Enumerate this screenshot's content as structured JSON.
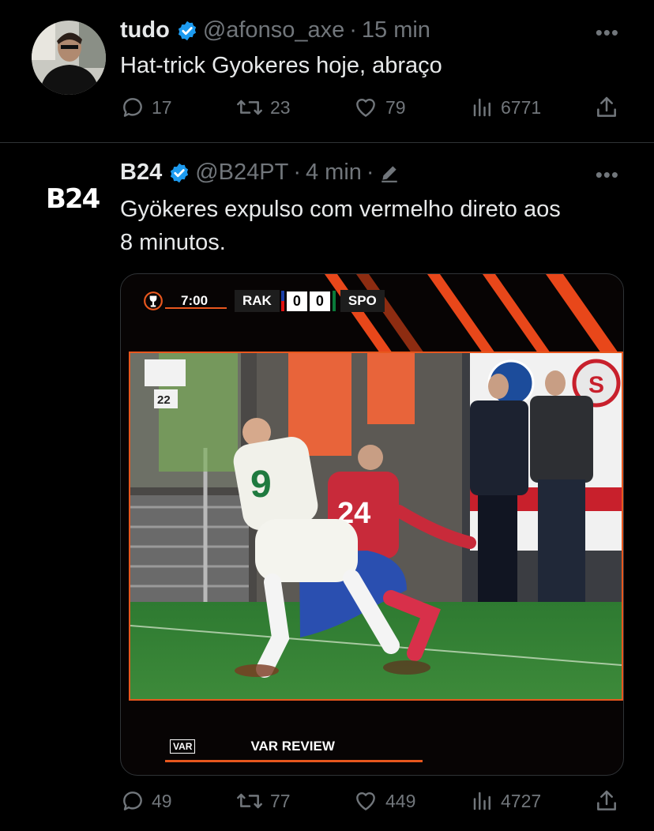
{
  "tweets": [
    {
      "author": {
        "name": "tudo",
        "handle": "@afonso_axe",
        "time": "15 min",
        "verified": true
      },
      "text": "Hat-trick Gyokeres hoje, abraço",
      "stats": {
        "replies": "17",
        "reposts": "23",
        "likes": "79",
        "views": "6771"
      }
    },
    {
      "author": {
        "name": "B24",
        "handle": "@B24PT",
        "time": "4 min",
        "verified": true,
        "logo_text": "B24"
      },
      "text": "Gyökeres expulso com vermelho direto aos\n8 minutos.",
      "media": {
        "match_clock": "7:00",
        "home": "RAK",
        "home_score": "0",
        "away_score": "0",
        "away": "SPO",
        "sign_number": "22",
        "player_white_number": "9",
        "player_red_number": "24",
        "var_badge": "VAR",
        "var_label": "VAR REVIEW"
      },
      "stats": {
        "replies": "49",
        "reposts": "77",
        "likes": "449",
        "views": "4727"
      }
    }
  ],
  "more_label": "•••",
  "colors": {
    "accent": "#1d9bf0",
    "muted": "#71767b",
    "broadcast_orange": "#e8571e"
  }
}
